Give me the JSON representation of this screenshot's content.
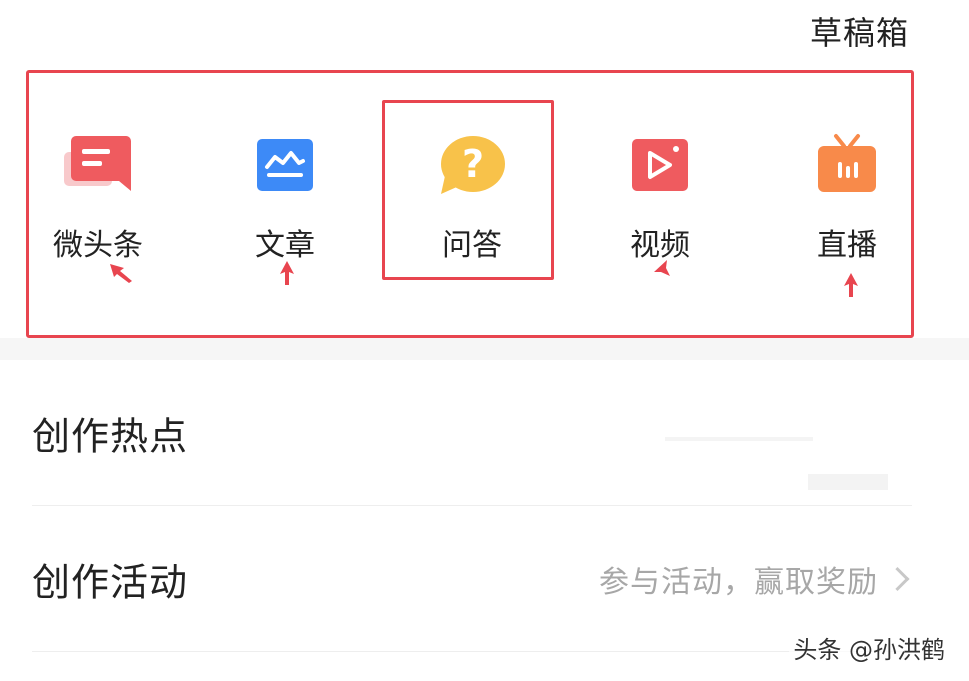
{
  "header": {
    "drafts_label": "草稿箱"
  },
  "tools": [
    {
      "label": "微头条",
      "icon": "micro-headline-icon",
      "color": "#ef5b5f"
    },
    {
      "label": "文章",
      "icon": "article-icon",
      "color": "#3d8af7"
    },
    {
      "label": "问答",
      "icon": "qa-icon",
      "color": "#f8c24a"
    },
    {
      "label": "视频",
      "icon": "video-icon",
      "color": "#ef5b5f"
    },
    {
      "label": "直播",
      "icon": "live-icon",
      "color": "#f88a4a"
    }
  ],
  "annotation_color": "#e8454f",
  "menu": [
    {
      "title": "创作热点",
      "subtitle": ""
    },
    {
      "title": "创作活动",
      "subtitle": "参与活动，赢取奖励"
    }
  ],
  "watermark": "头条 @孙洪鹤"
}
